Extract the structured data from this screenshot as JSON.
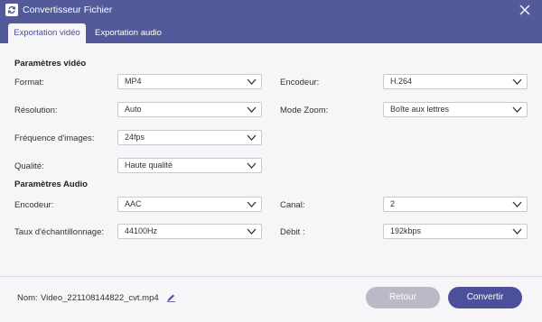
{
  "window": {
    "title": "Convertisseur Fichier",
    "accent_color": "#525a9a",
    "icons": {
      "app": "refresh-icon",
      "close": "close-icon"
    }
  },
  "tabs": [
    {
      "label": "Exportation vidéo",
      "active": true
    },
    {
      "label": "Exportation audio",
      "active": false
    }
  ],
  "video": {
    "section_title": "Paramètres vidéo",
    "format": {
      "label": "Format:",
      "value": "MP4"
    },
    "encoder": {
      "label": "Encodeur:",
      "value": "H.264"
    },
    "resolution": {
      "label": "Résolution:",
      "value": "Auto"
    },
    "zoom_mode": {
      "label": "Mode Zoom:",
      "value": "Boîte aux lettres"
    },
    "frame_rate": {
      "label": "Fréquence d'images:",
      "value": "24fps"
    },
    "quality": {
      "label": "Qualité:",
      "value": "Haute qualité"
    }
  },
  "audio": {
    "section_title": "Paramètres Audio",
    "encoder": {
      "label": "Encodeur:",
      "value": "AAC"
    },
    "channel": {
      "label": "Canal:",
      "value": "2"
    },
    "sample_rate": {
      "label": "Taux d'échantillonnage:",
      "value": "44100Hz"
    },
    "bitrate": {
      "label": "Débit :",
      "value": "192kbps"
    }
  },
  "footer": {
    "name_label": "Nom:",
    "filename": "Video_221108144822_cvt.mp4",
    "back_label": "Retour",
    "convert_label": "Convertir",
    "icons": {
      "edit": "pencil-icon"
    }
  }
}
